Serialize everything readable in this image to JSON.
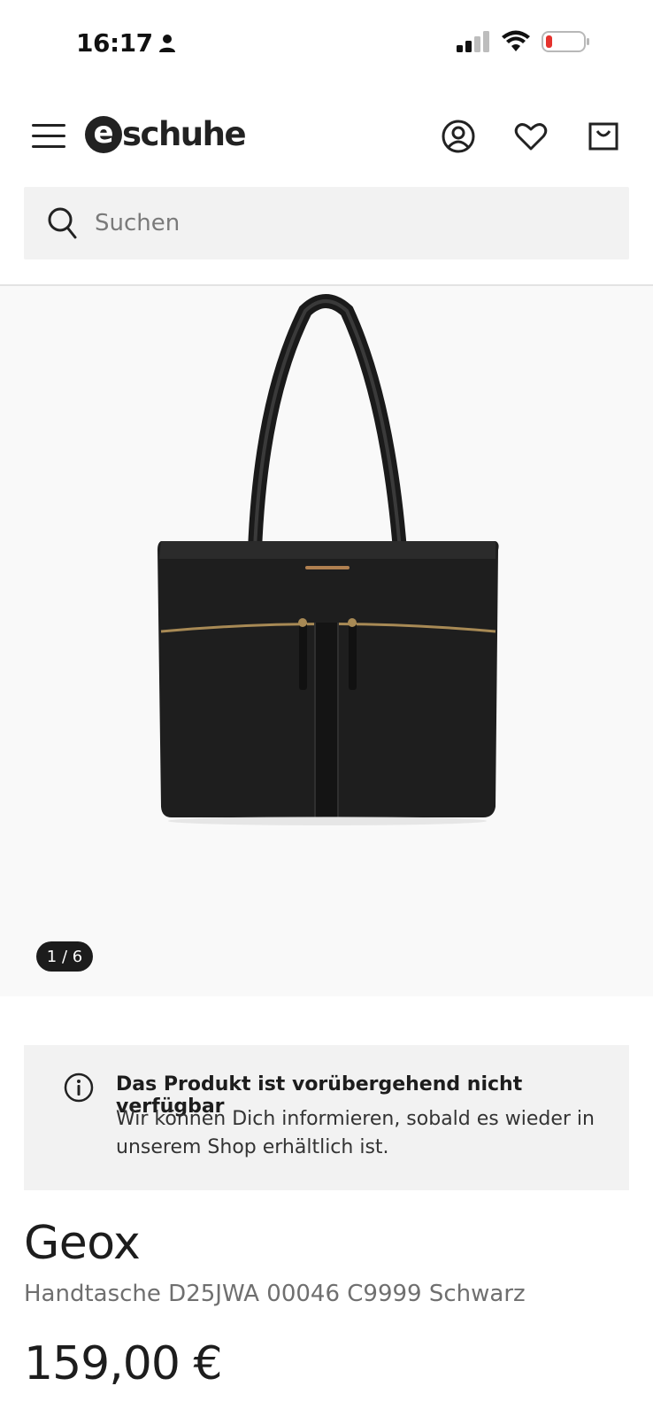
{
  "status_bar": {
    "time": "16:17",
    "battery_color": "#e5322d"
  },
  "header": {
    "logo_mark": "e",
    "logo_text": "schuhe",
    "icons": [
      "menu-icon",
      "account-icon",
      "heart-icon",
      "cart-icon"
    ]
  },
  "search": {
    "placeholder": "Suchen"
  },
  "gallery": {
    "counter": "1 / 6",
    "image": "black-leather-tote-bag"
  },
  "availability": {
    "title": "Das Produkt ist vorübergehend nicht verfügbar",
    "text": "Wir können Dich informieren, sobald es wieder in unserem Shop erhältlich ist."
  },
  "product": {
    "brand": "Geox",
    "name": "Handtasche D25JWA 00046 C9999 Schwarz",
    "price": "159,00 €"
  }
}
